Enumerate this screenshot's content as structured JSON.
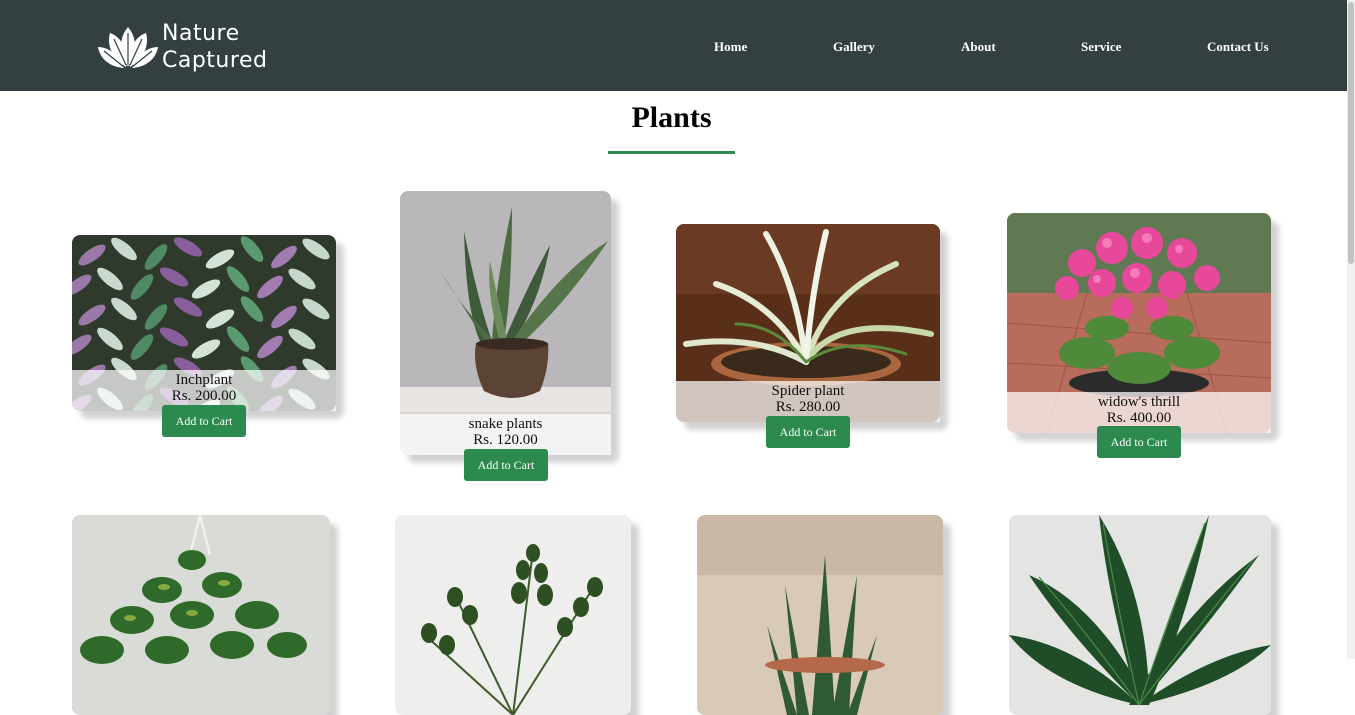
{
  "brand": {
    "line1": "Nature",
    "line2": "Captured",
    "logo_icon": "leaf-icon"
  },
  "nav": [
    "Home",
    "Gallery",
    "About",
    "Service",
    "Contact Us"
  ],
  "page": {
    "title": "Plants"
  },
  "products": [
    {
      "name": "Inchplant",
      "price": "Rs. 200.00",
      "button": "Add to Cart"
    },
    {
      "name": "snake plants",
      "price": "Rs. 120.00",
      "button": "Add to Cart"
    },
    {
      "name": "Spider plant",
      "price": "Rs. 280.00",
      "button": "Add to Cart"
    },
    {
      "name": "widow's thrill",
      "price": "Rs. 400.00",
      "button": "Add to Cart"
    }
  ],
  "colors": {
    "navbar": "#343f41",
    "accent": "#2c8a4f"
  }
}
